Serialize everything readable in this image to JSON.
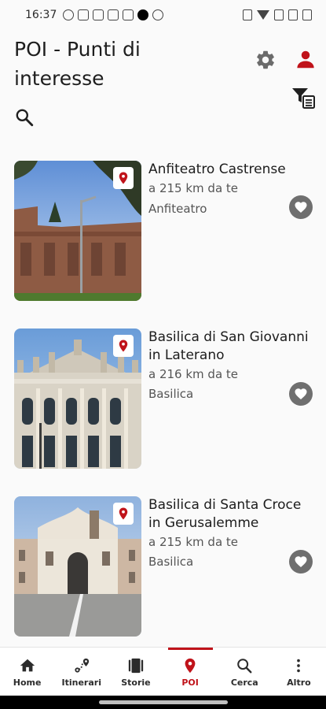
{
  "status_bar": {
    "time": "16:37"
  },
  "header": {
    "title": "POI - Punti di interesse"
  },
  "colors": {
    "accent": "#c0131a",
    "favorite_bg": "#6f6f6f"
  },
  "icons": {
    "settings": "gear-icon",
    "account": "user-icon",
    "filter": "filter-list-icon",
    "search": "search-icon"
  },
  "poi_list": [
    {
      "name": "Anfiteatro Castrense",
      "distance": "a 215 km da te",
      "category": "Anfiteatro"
    },
    {
      "name": "Basilica di San Giovanni in Laterano",
      "distance": "a 216 km da te",
      "category": "Basilica"
    },
    {
      "name": "Basilica di Santa Croce in Gerusalemme",
      "distance": "a 215 km da te",
      "category": "Basilica"
    }
  ],
  "bottom_nav": [
    {
      "label": "Home",
      "icon": "home-icon",
      "active": false
    },
    {
      "label": "Itinerari",
      "icon": "route-icon",
      "active": false
    },
    {
      "label": "Storie",
      "icon": "stories-icon",
      "active": false
    },
    {
      "label": "POI",
      "icon": "map-pin-icon",
      "active": true
    },
    {
      "label": "Cerca",
      "icon": "search-icon",
      "active": false
    },
    {
      "label": "Altro",
      "icon": "more-vertical-icon",
      "active": false
    }
  ]
}
